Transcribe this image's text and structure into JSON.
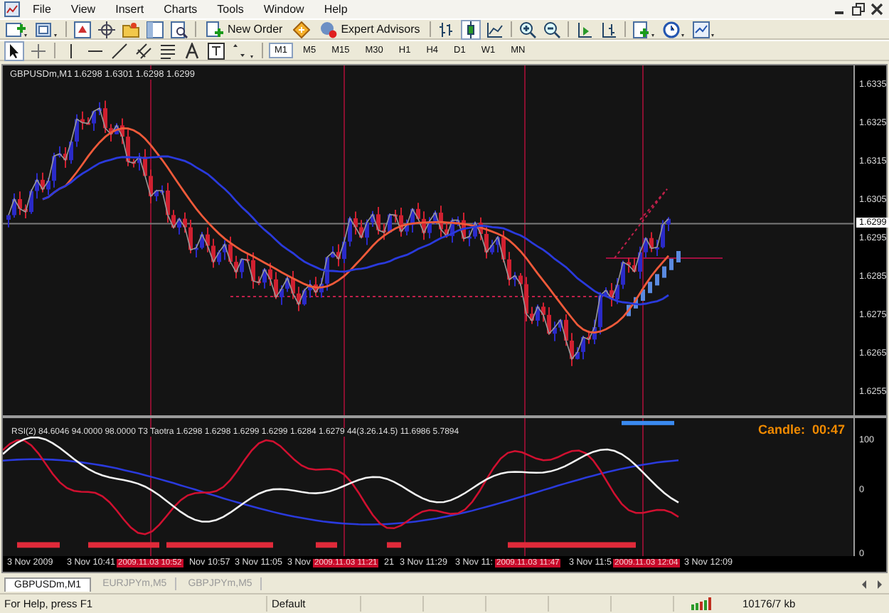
{
  "menu": [
    "File",
    "View",
    "Insert",
    "Charts",
    "Tools",
    "Window",
    "Help"
  ],
  "toolbar_buttons": [
    "New Order",
    "Expert Advisors"
  ],
  "timeframes": [
    {
      "label": "M1",
      "selected": true
    },
    {
      "label": "M5",
      "selected": false
    },
    {
      "label": "M15",
      "selected": false
    },
    {
      "label": "M30",
      "selected": false
    },
    {
      "label": "H1",
      "selected": false
    },
    {
      "label": "H4",
      "selected": false
    },
    {
      "label": "D1",
      "selected": false
    },
    {
      "label": "W1",
      "selected": false
    },
    {
      "label": "MN",
      "selected": false
    }
  ],
  "chart": {
    "title": "GBPUSDm,M1",
    "quote": "1.6298 1.6301 1.6298 1.6299",
    "price_axis": [
      "1.6335",
      "1.6325",
      "1.6315",
      "1.6305",
      "1.6295",
      "1.6285",
      "1.6275",
      "1.6265",
      "1.6255"
    ],
    "current_price": "1.6299"
  },
  "indicator": {
    "header": "RSI(2) 84.6046 94.0000 98.0000  T3 Taotra 1.6298 1.6298 1.6299 1.6299 1.6284 1.6279 44(3.26.14.5) 11.6986 5.7894",
    "candle_label": "Candle:",
    "candle_time": "00:47",
    "axis": [
      "100",
      "0",
      "0"
    ]
  },
  "time_axis": [
    {
      "label": "3 Nov 2009",
      "highlighted": false
    },
    {
      "label": "3 Nov 10:41",
      "highlighted": false
    },
    {
      "label": "2009.11.03 10:52",
      "highlighted": true
    },
    {
      "label": "Nov 10:57",
      "highlighted": false
    },
    {
      "label": "3 Nov 11:05",
      "highlighted": false
    },
    {
      "label": "3 Nov",
      "highlighted": false
    },
    {
      "label": "2009.11.03 11:21",
      "highlighted": true
    },
    {
      "label": "21",
      "highlighted": false
    },
    {
      "label": "3 Nov 11:29",
      "highlighted": false
    },
    {
      "label": "3 Nov 11:",
      "highlighted": false
    },
    {
      "label": "2009.11.03 11:47",
      "highlighted": true
    },
    {
      "label": "3 Nov 11:5",
      "highlighted": false
    },
    {
      "label": "2009.11.03 12:04",
      "highlighted": true
    },
    {
      "label": "3 Nov 12:09",
      "highlighted": false
    }
  ],
  "tabs": [
    {
      "label": "GBPUSDm,M1",
      "selected": true
    },
    {
      "label": "EURJPYm,M5",
      "selected": false
    },
    {
      "label": "GBPJPYm,M5",
      "selected": false
    }
  ],
  "status_bar": [
    "For Help, press F1",
    "Default",
    "10176/7 kb"
  ]
}
